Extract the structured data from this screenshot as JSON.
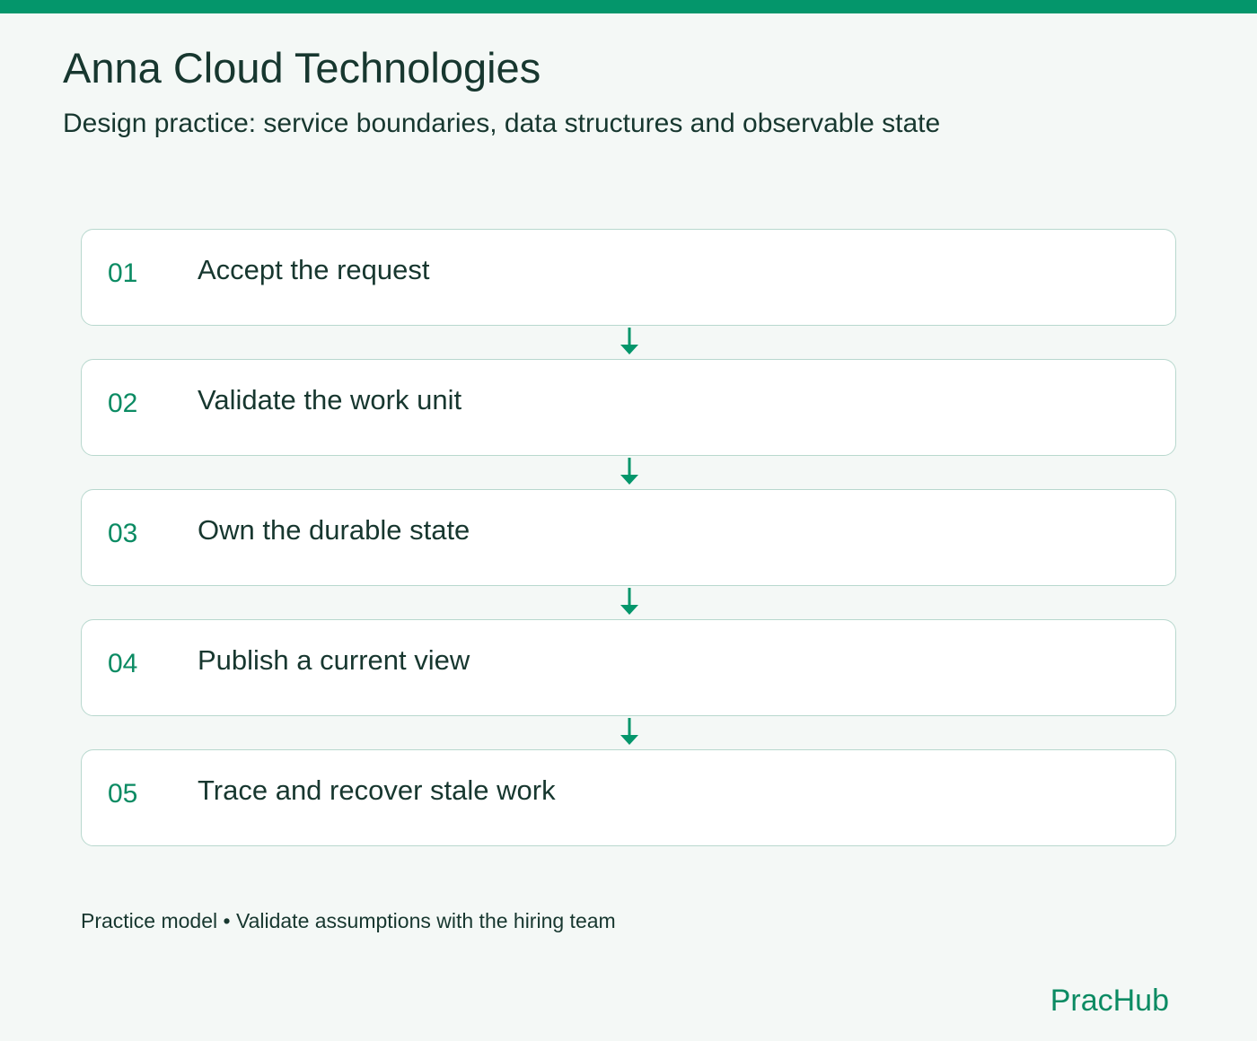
{
  "header": {
    "title": "Anna Cloud Technologies",
    "subtitle": "Design practice: service boundaries, data structures and observable state"
  },
  "steps": [
    {
      "number": "01",
      "label": "Accept the request"
    },
    {
      "number": "02",
      "label": "Validate the work unit"
    },
    {
      "number": "03",
      "label": "Own the durable state"
    },
    {
      "number": "04",
      "label": "Publish a current view"
    },
    {
      "number": "05",
      "label": "Trace and recover stale work"
    }
  ],
  "footer": {
    "note": "Practice model • Validate assumptions with the hiring team",
    "brand": "PracHub"
  },
  "colors": {
    "accent": "#04966b",
    "text": "#17372f",
    "card_border": "#b8d8ce",
    "background": "#f4f8f6"
  },
  "icons": [
    "arrow-down-icon"
  ]
}
